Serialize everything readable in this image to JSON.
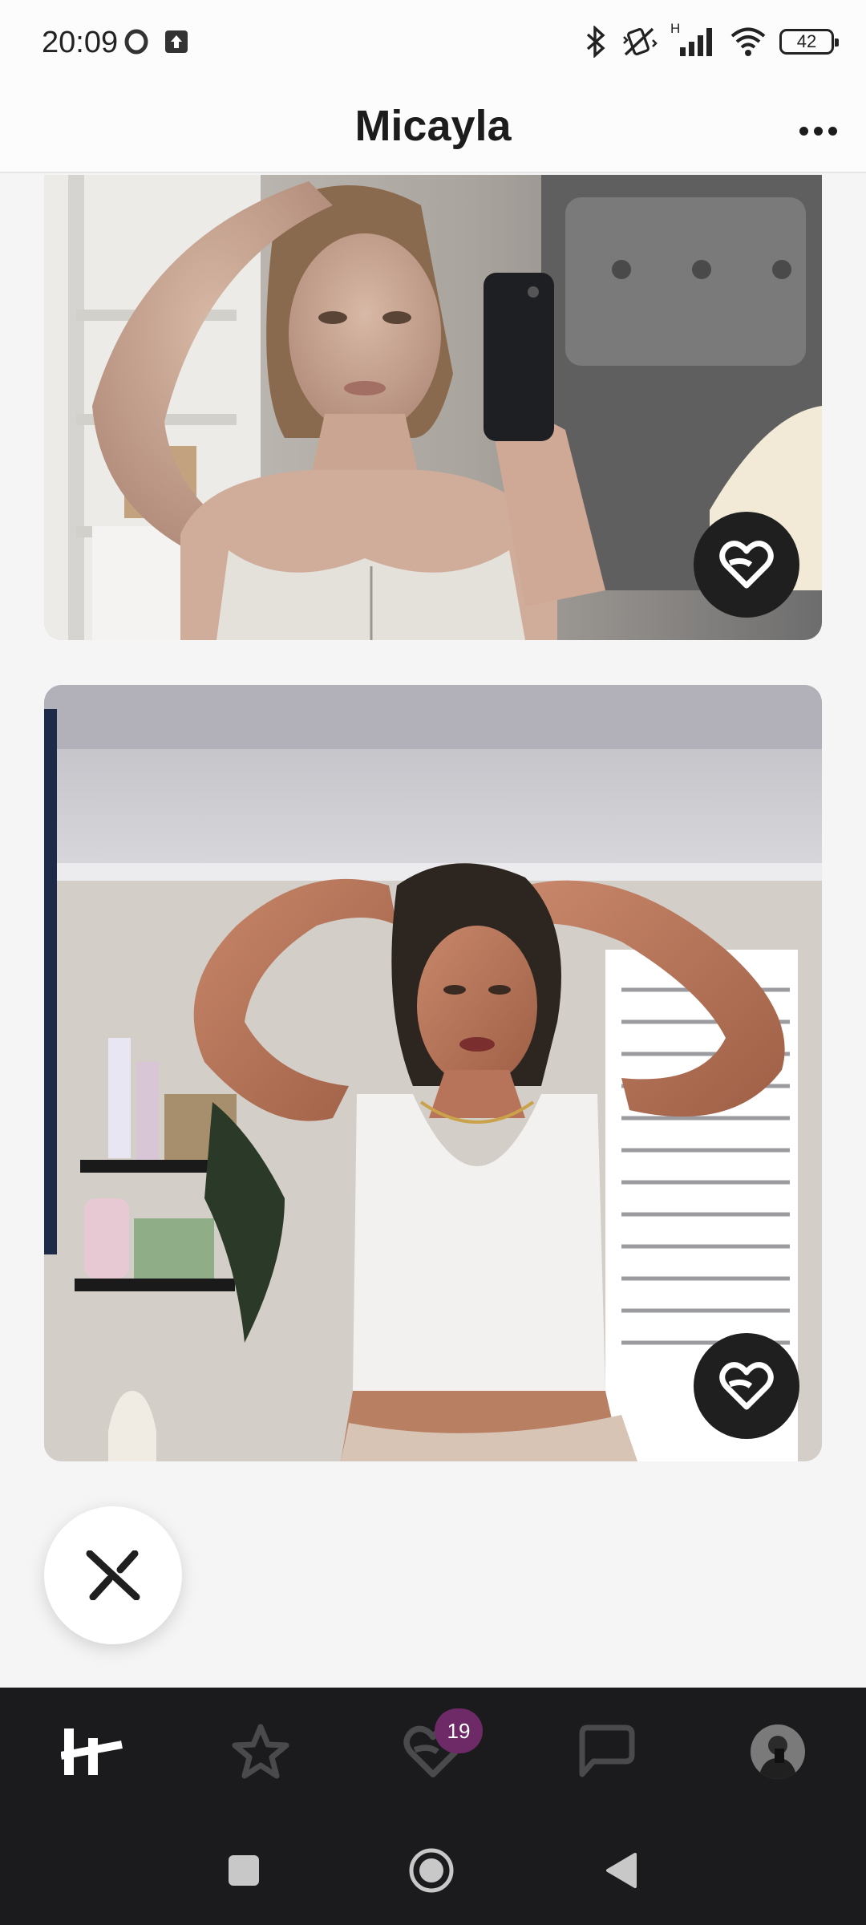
{
  "status_bar": {
    "time": "20:09",
    "battery": "42",
    "network_label": "H",
    "icons": [
      "opera-icon",
      "upload-icon",
      "bluetooth-icon",
      "vibrate-off-icon",
      "signal-icon",
      "wifi-icon",
      "battery-icon"
    ]
  },
  "header": {
    "title": "Micayla",
    "more_icon": "more-horizontal-icon"
  },
  "cards": [
    {
      "type": "photo",
      "like_icon": "heart-like-icon"
    },
    {
      "type": "photo",
      "like_icon": "heart-like-icon"
    }
  ],
  "pass_button": {
    "icon": "close-x-icon"
  },
  "bottom_nav": {
    "items": [
      {
        "name": "discover",
        "icon": "hinge-logo-icon",
        "active": true
      },
      {
        "name": "standouts",
        "icon": "star-icon"
      },
      {
        "name": "likes-you",
        "icon": "heart-icon",
        "badge": "19"
      },
      {
        "name": "matches",
        "icon": "chat-icon"
      },
      {
        "name": "profile",
        "icon": "avatar"
      }
    ],
    "colors": {
      "background": "#1b1b1d",
      "active": "#ffffff",
      "inactive": "#4a4a4c",
      "badge": "#6e2a66"
    }
  },
  "system_nav": {
    "items": [
      "recents-square-icon",
      "home-circle-icon",
      "back-triangle-icon"
    ]
  }
}
